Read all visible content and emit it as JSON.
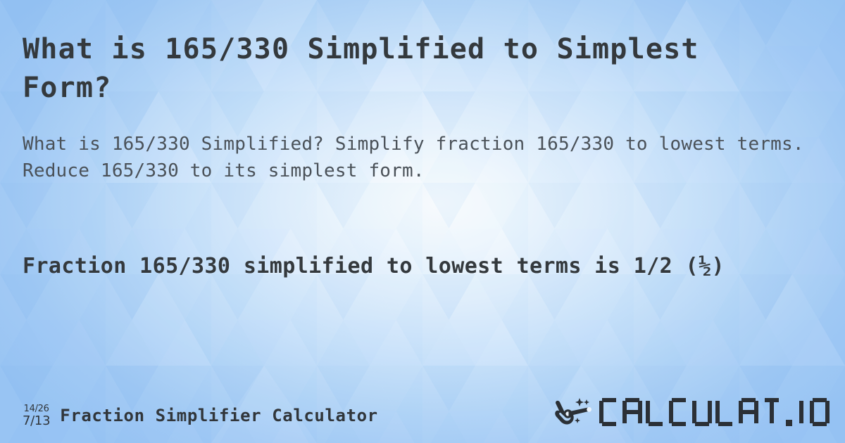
{
  "page": {
    "title": "What is 165/330 Simplified to Simplest Form?",
    "subtitle": "What is 165/330 Simplified? Simplify fraction 165/330 to lowest terms. Reduce 165/330 to its simplest form.",
    "result": "Fraction 165/330 simplified to lowest terms is 1/2 (½)",
    "result_lead": "Fraction 165/330 simplified to lowest terms is",
    "result_value": "1/2",
    "result_value_unicode": "(½)"
  },
  "fraction": {
    "numerator": "165",
    "denominator": "330",
    "simplified_numerator": "1",
    "simplified_denominator": "2",
    "simplified_display": "1/2",
    "simplified_unicode": "½"
  },
  "footer": {
    "badge": {
      "numerator_fraction": "14/26",
      "denominator_fraction": "7/13"
    },
    "calculator_name": "Fraction Simplifier Calculator",
    "logo_text": "CALCULAT.IO",
    "logo_icon": "hand-holding-magic-wand-icon"
  },
  "colors": {
    "background_center": "#ffffff",
    "background_edge": "#a8cef6",
    "heading_text": "#34393d",
    "body_text": "#4a5158",
    "logo_dark": "#2b3036"
  }
}
